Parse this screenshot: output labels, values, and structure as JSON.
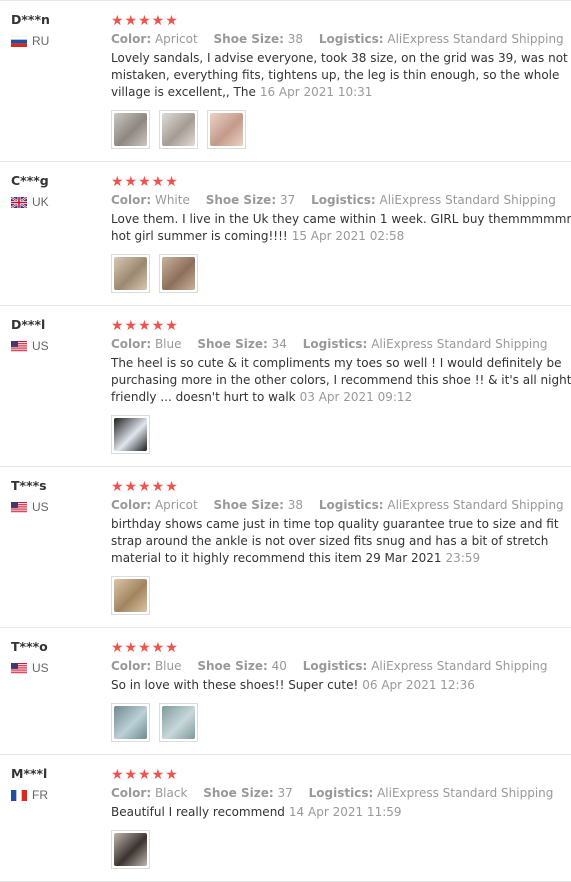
{
  "labels": {
    "color": "Color:",
    "size": "Shoe Size:",
    "logistics": "Logistics:"
  },
  "stars": "★★★★★",
  "reviews": [
    {
      "user": "D***n",
      "country": "RU",
      "flag": "ru",
      "color": "Apricot",
      "size": "38",
      "logistics": "AliExpress Standard Shipping",
      "text": "Lovely sandals, I advise everyone, took 38 size, on the grid was 39, was not mistaken, everything fits, tightens up, the leg is thin enough, so the whole village is excellent,, The",
      "date": "16 Apr 2021 10:31",
      "photos": [
        [
          "#ccc7c2",
          "#8e8680"
        ],
        [
          "#e0dcd6",
          "#a49c94"
        ],
        [
          "#e9d3c7",
          "#c49a8a"
        ]
      ]
    },
    {
      "user": "C***g",
      "country": "UK",
      "flag": "uk",
      "color": "White",
      "size": "37",
      "logistics": "AliExpress Standard Shipping",
      "text": "Love them. I live in the Uk they came within 1 week. GIRL buy themmmmmm hot girl summer is coming!!!!",
      "date": "15 Apr 2021 02:58",
      "photos": [
        [
          "#d8c9b4",
          "#9c8870"
        ],
        [
          "#c9b39c",
          "#8c6f5c"
        ]
      ]
    },
    {
      "user": "D***l",
      "country": "US",
      "flag": "us",
      "color": "Blue",
      "size": "34",
      "logistics": "AliExpress Standard Shipping",
      "text": "The heel is so cute & it compliments my toes so well ! I would definitely be purchasing more in the other colors, I recommend this shoe !! & it's all night friendly ... doesn't hurt to walk",
      "date": "03 Apr 2021 09:12",
      "photos": [
        [
          "#1e1e1e",
          "#e0e6ee"
        ]
      ]
    },
    {
      "user": "T***s",
      "country": "US",
      "flag": "us",
      "color": "Apricot",
      "size": "38",
      "logistics": "AliExpress Standard Shipping",
      "text": "birthday shows came just in time top quality guarantee true to size and fit strap around the ankle is not over sized fits snug and has a bit of stretch material to it highly recommend this item 29 Mar 2021",
      "date": "23:59",
      "photos": [
        [
          "#d9c5a8",
          "#a2845f"
        ]
      ]
    },
    {
      "user": "T***o",
      "country": "US",
      "flag": "us",
      "color": "Blue",
      "size": "40",
      "logistics": "AliExpress Standard Shipping",
      "text": "So in love with these shoes!! Super cute!",
      "date": "06 Apr 2021 12:36",
      "photos": [
        [
          "#6f8a8e",
          "#bcd0d6"
        ],
        [
          "#7d9a9a",
          "#c8d8da"
        ]
      ]
    },
    {
      "user": "M***l",
      "country": "FR",
      "flag": "fr",
      "color": "Black",
      "size": "37",
      "logistics": "AliExpress Standard Shipping",
      "text": "Beautiful I really recommend",
      "date": "14 Apr 2021 11:59",
      "photos": [
        [
          "#bfb6ad",
          "#3a3330"
        ]
      ]
    }
  ]
}
